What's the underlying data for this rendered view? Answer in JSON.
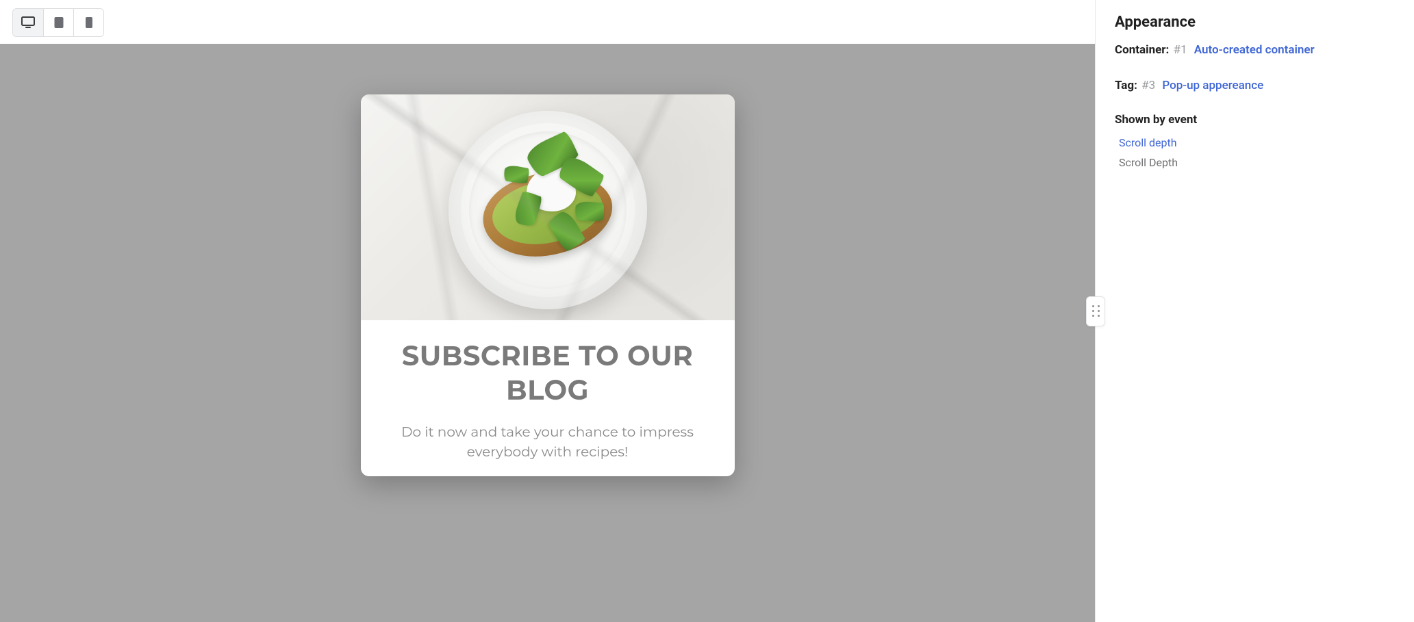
{
  "toolbar": {
    "devices": [
      {
        "name": "desktop",
        "active": true
      },
      {
        "name": "tablet",
        "active": false
      },
      {
        "name": "mobile",
        "active": false
      }
    ]
  },
  "popup": {
    "title": "SUBSCRIBE TO OUR BLOG",
    "subtitle": "Do it now and take your chance to impress everybody with recipes!"
  },
  "sidebar": {
    "title": "Appearance",
    "container": {
      "label": "Container:",
      "num": "#1",
      "link": "Auto-created container"
    },
    "tag": {
      "label": "Tag:",
      "num": "#3",
      "link": "Pop-up appereance"
    },
    "events": {
      "heading": "Shown by event",
      "link": "Scroll depth",
      "static": "Scroll Depth"
    }
  }
}
